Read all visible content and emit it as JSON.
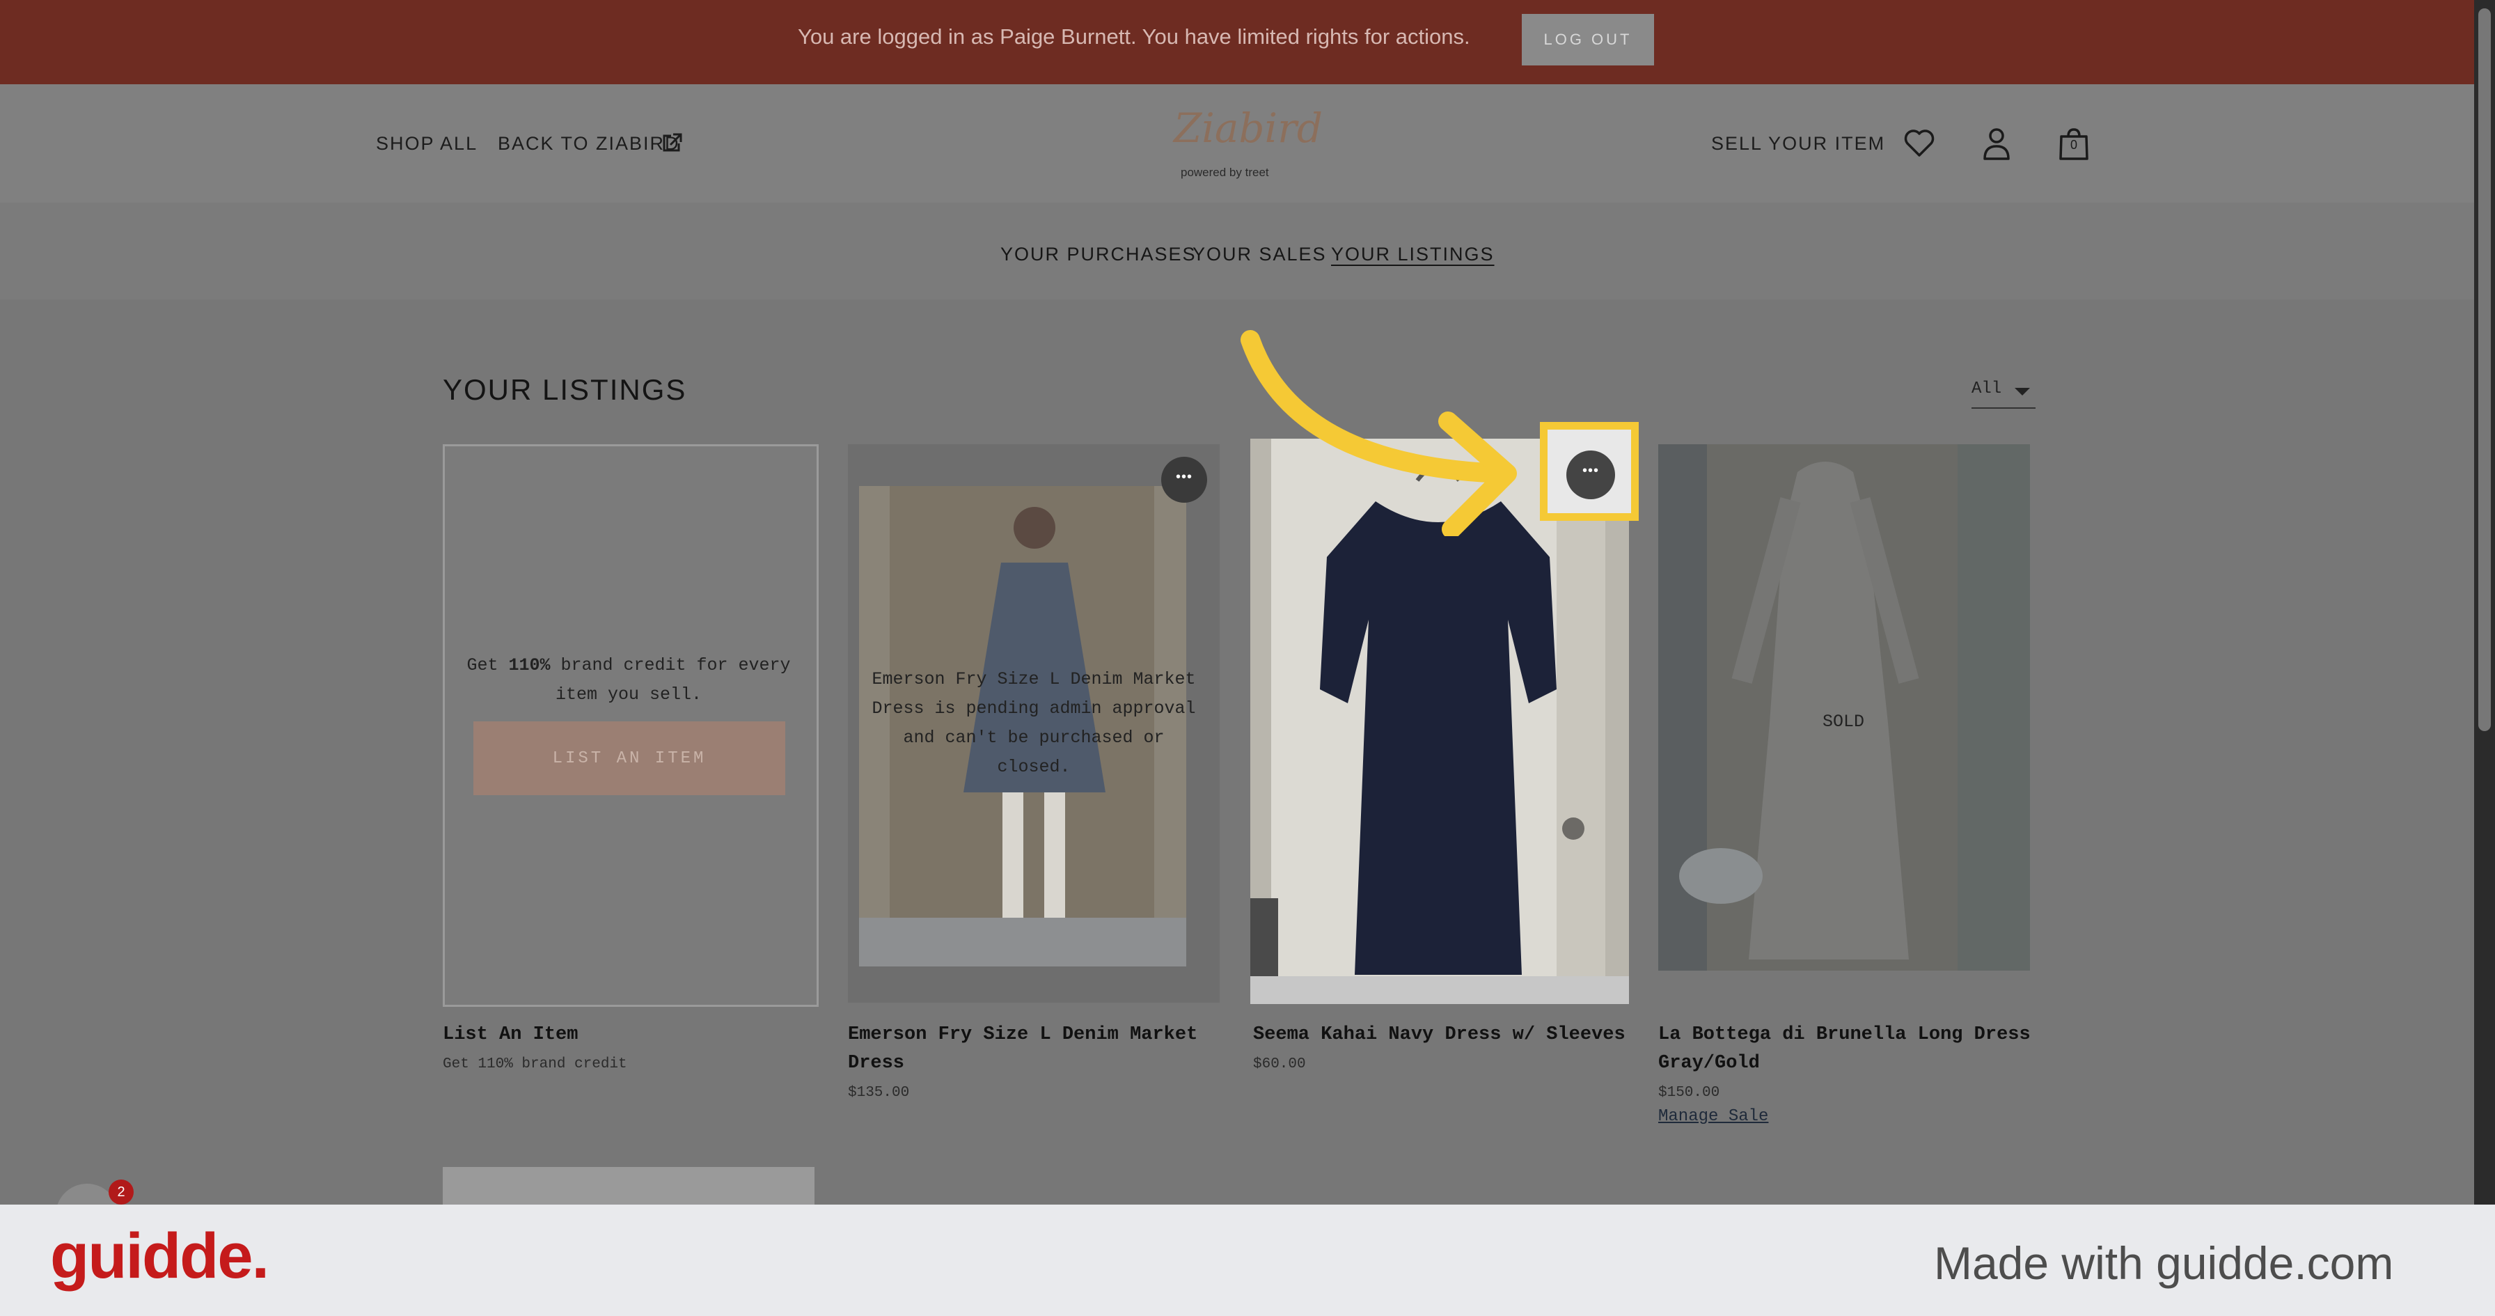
{
  "banner": {
    "message": "You are logged in as Paige Burnett. You have limited rights for actions.",
    "logout_label": "LOG OUT"
  },
  "header": {
    "shop_all": "SHOP ALL",
    "back_link": "BACK TO ZIABIRD",
    "logo_script": "Ziabird",
    "logo_powered": "powered by treet",
    "sell_item": "SELL YOUR ITEM",
    "cart_count": "0",
    "icons": [
      "external-link-icon",
      "heart-icon",
      "user-icon",
      "bag-icon"
    ]
  },
  "tabs": {
    "purchases": "YOUR PURCHASES",
    "sales": "YOUR SALES",
    "listings": "YOUR LISTINGS",
    "active": "listings"
  },
  "listings": {
    "title": "YOUR LISTINGS",
    "filter": "All",
    "list_card": {
      "promo_prefix": "Get ",
      "promo_bold": "110%",
      "promo_suffix": " brand credit for every item you sell.",
      "button_label": "LIST AN ITEM",
      "name": "List An Item",
      "subtitle": "Get 110% brand credit"
    },
    "items": [
      {
        "name": "Emerson Fry Size L Denim Market Dress",
        "price": "$135.00",
        "overlay": "Emerson Fry Size L Denim Market Dress is pending admin approval and can't be purchased or closed."
      },
      {
        "name": "Seema Kahai Navy Dress w/ Sleeves",
        "price": "$60.00"
      },
      {
        "name": "La Bottega di Brunella Long Dress Gray/Gold",
        "price": "$150.00",
        "status": "SOLD",
        "action": "Manage Sale"
      }
    ]
  },
  "chat_badge": "2",
  "footer": {
    "brand": "guidde.",
    "made_with": "Made with guidde.com"
  },
  "colors": {
    "banner": "#6e2c22",
    "highlight": "#f5c935",
    "brand_red": "#c51b1b"
  }
}
